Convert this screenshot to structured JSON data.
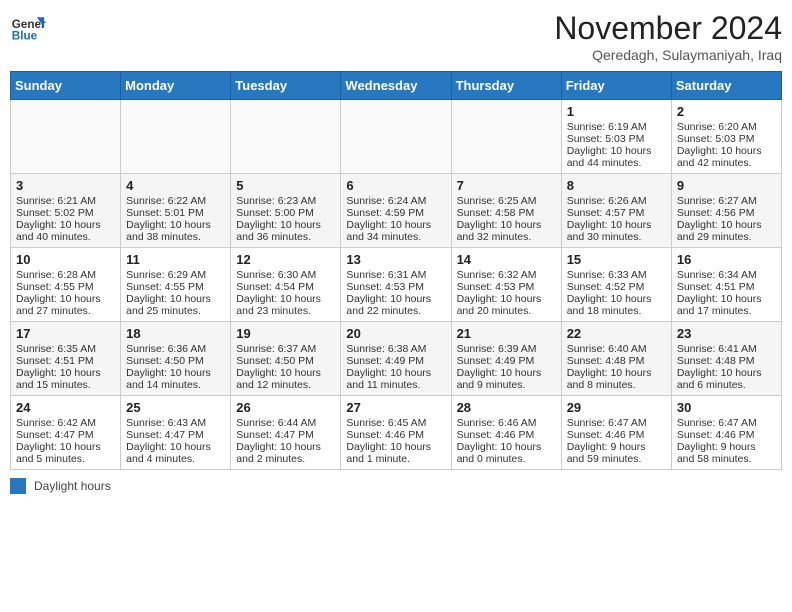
{
  "header": {
    "logo_general": "General",
    "logo_blue": "Blue",
    "month_title": "November 2024",
    "location": "Qeredagh, Sulaymaniyah, Iraq"
  },
  "days_of_week": [
    "Sunday",
    "Monday",
    "Tuesday",
    "Wednesday",
    "Thursday",
    "Friday",
    "Saturday"
  ],
  "legend_label": "Daylight hours",
  "weeks": [
    [
      {
        "day": "",
        "sunrise": "",
        "sunset": "",
        "daylight": ""
      },
      {
        "day": "",
        "sunrise": "",
        "sunset": "",
        "daylight": ""
      },
      {
        "day": "",
        "sunrise": "",
        "sunset": "",
        "daylight": ""
      },
      {
        "day": "",
        "sunrise": "",
        "sunset": "",
        "daylight": ""
      },
      {
        "day": "",
        "sunrise": "",
        "sunset": "",
        "daylight": ""
      },
      {
        "day": "1",
        "sunrise": "Sunrise: 6:19 AM",
        "sunset": "Sunset: 5:03 PM",
        "daylight": "Daylight: 10 hours and 44 minutes."
      },
      {
        "day": "2",
        "sunrise": "Sunrise: 6:20 AM",
        "sunset": "Sunset: 5:03 PM",
        "daylight": "Daylight: 10 hours and 42 minutes."
      }
    ],
    [
      {
        "day": "3",
        "sunrise": "Sunrise: 6:21 AM",
        "sunset": "Sunset: 5:02 PM",
        "daylight": "Daylight: 10 hours and 40 minutes."
      },
      {
        "day": "4",
        "sunrise": "Sunrise: 6:22 AM",
        "sunset": "Sunset: 5:01 PM",
        "daylight": "Daylight: 10 hours and 38 minutes."
      },
      {
        "day": "5",
        "sunrise": "Sunrise: 6:23 AM",
        "sunset": "Sunset: 5:00 PM",
        "daylight": "Daylight: 10 hours and 36 minutes."
      },
      {
        "day": "6",
        "sunrise": "Sunrise: 6:24 AM",
        "sunset": "Sunset: 4:59 PM",
        "daylight": "Daylight: 10 hours and 34 minutes."
      },
      {
        "day": "7",
        "sunrise": "Sunrise: 6:25 AM",
        "sunset": "Sunset: 4:58 PM",
        "daylight": "Daylight: 10 hours and 32 minutes."
      },
      {
        "day": "8",
        "sunrise": "Sunrise: 6:26 AM",
        "sunset": "Sunset: 4:57 PM",
        "daylight": "Daylight: 10 hours and 30 minutes."
      },
      {
        "day": "9",
        "sunrise": "Sunrise: 6:27 AM",
        "sunset": "Sunset: 4:56 PM",
        "daylight": "Daylight: 10 hours and 29 minutes."
      }
    ],
    [
      {
        "day": "10",
        "sunrise": "Sunrise: 6:28 AM",
        "sunset": "Sunset: 4:55 PM",
        "daylight": "Daylight: 10 hours and 27 minutes."
      },
      {
        "day": "11",
        "sunrise": "Sunrise: 6:29 AM",
        "sunset": "Sunset: 4:55 PM",
        "daylight": "Daylight: 10 hours and 25 minutes."
      },
      {
        "day": "12",
        "sunrise": "Sunrise: 6:30 AM",
        "sunset": "Sunset: 4:54 PM",
        "daylight": "Daylight: 10 hours and 23 minutes."
      },
      {
        "day": "13",
        "sunrise": "Sunrise: 6:31 AM",
        "sunset": "Sunset: 4:53 PM",
        "daylight": "Daylight: 10 hours and 22 minutes."
      },
      {
        "day": "14",
        "sunrise": "Sunrise: 6:32 AM",
        "sunset": "Sunset: 4:53 PM",
        "daylight": "Daylight: 10 hours and 20 minutes."
      },
      {
        "day": "15",
        "sunrise": "Sunrise: 6:33 AM",
        "sunset": "Sunset: 4:52 PM",
        "daylight": "Daylight: 10 hours and 18 minutes."
      },
      {
        "day": "16",
        "sunrise": "Sunrise: 6:34 AM",
        "sunset": "Sunset: 4:51 PM",
        "daylight": "Daylight: 10 hours and 17 minutes."
      }
    ],
    [
      {
        "day": "17",
        "sunrise": "Sunrise: 6:35 AM",
        "sunset": "Sunset: 4:51 PM",
        "daylight": "Daylight: 10 hours and 15 minutes."
      },
      {
        "day": "18",
        "sunrise": "Sunrise: 6:36 AM",
        "sunset": "Sunset: 4:50 PM",
        "daylight": "Daylight: 10 hours and 14 minutes."
      },
      {
        "day": "19",
        "sunrise": "Sunrise: 6:37 AM",
        "sunset": "Sunset: 4:50 PM",
        "daylight": "Daylight: 10 hours and 12 minutes."
      },
      {
        "day": "20",
        "sunrise": "Sunrise: 6:38 AM",
        "sunset": "Sunset: 4:49 PM",
        "daylight": "Daylight: 10 hours and 11 minutes."
      },
      {
        "day": "21",
        "sunrise": "Sunrise: 6:39 AM",
        "sunset": "Sunset: 4:49 PM",
        "daylight": "Daylight: 10 hours and 9 minutes."
      },
      {
        "day": "22",
        "sunrise": "Sunrise: 6:40 AM",
        "sunset": "Sunset: 4:48 PM",
        "daylight": "Daylight: 10 hours and 8 minutes."
      },
      {
        "day": "23",
        "sunrise": "Sunrise: 6:41 AM",
        "sunset": "Sunset: 4:48 PM",
        "daylight": "Daylight: 10 hours and 6 minutes."
      }
    ],
    [
      {
        "day": "24",
        "sunrise": "Sunrise: 6:42 AM",
        "sunset": "Sunset: 4:47 PM",
        "daylight": "Daylight: 10 hours and 5 minutes."
      },
      {
        "day": "25",
        "sunrise": "Sunrise: 6:43 AM",
        "sunset": "Sunset: 4:47 PM",
        "daylight": "Daylight: 10 hours and 4 minutes."
      },
      {
        "day": "26",
        "sunrise": "Sunrise: 6:44 AM",
        "sunset": "Sunset: 4:47 PM",
        "daylight": "Daylight: 10 hours and 2 minutes."
      },
      {
        "day": "27",
        "sunrise": "Sunrise: 6:45 AM",
        "sunset": "Sunset: 4:46 PM",
        "daylight": "Daylight: 10 hours and 1 minute."
      },
      {
        "day": "28",
        "sunrise": "Sunrise: 6:46 AM",
        "sunset": "Sunset: 4:46 PM",
        "daylight": "Daylight: 10 hours and 0 minutes."
      },
      {
        "day": "29",
        "sunrise": "Sunrise: 6:47 AM",
        "sunset": "Sunset: 4:46 PM",
        "daylight": "Daylight: 9 hours and 59 minutes."
      },
      {
        "day": "30",
        "sunrise": "Sunrise: 6:47 AM",
        "sunset": "Sunset: 4:46 PM",
        "daylight": "Daylight: 9 hours and 58 minutes."
      }
    ]
  ]
}
